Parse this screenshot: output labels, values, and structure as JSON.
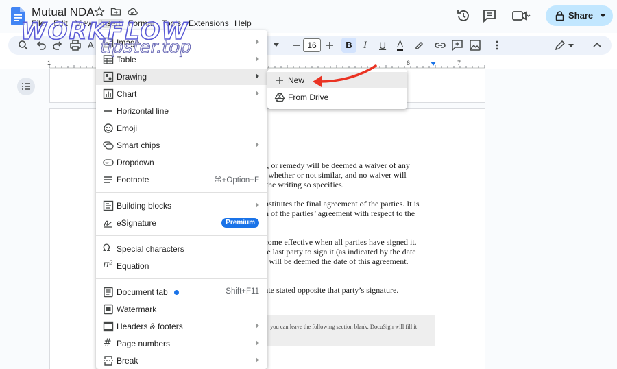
{
  "app": {
    "doc_title": "Mutual NDA",
    "share_label": "Share"
  },
  "menubar": {
    "items": [
      "File",
      "Edit",
      "View",
      "Insert",
      "Format",
      "Tools",
      "Extensions",
      "Help"
    ]
  },
  "toolbar": {
    "font_size": "16",
    "bold_label": "B",
    "italic_label": "I",
    "underline_label": "U",
    "text_color_label": "A",
    "ruler_numbers": [
      "1",
      "6",
      "7"
    ]
  },
  "insert_menu": {
    "items": [
      {
        "label": "Image",
        "icon": "image-icon",
        "submenu": true
      },
      {
        "label": "Table",
        "icon": "table-icon",
        "submenu": true
      },
      {
        "label": "Drawing",
        "icon": "drawing-icon",
        "submenu": true
      },
      {
        "label": "Chart",
        "icon": "chart-icon",
        "submenu": true
      },
      {
        "label": "Horizontal line",
        "icon": "horizontal-line-icon"
      },
      {
        "label": "Emoji",
        "icon": "emoji-icon"
      },
      {
        "label": "Smart chips",
        "icon": "smart-chips-icon",
        "submenu": true
      },
      {
        "label": "Dropdown",
        "icon": "dropdown-icon"
      },
      {
        "label": "Footnote",
        "icon": "footnote-icon",
        "shortcut": "⌘+Option+F"
      },
      {
        "label": "Building blocks",
        "icon": "building-blocks-icon",
        "submenu": true
      },
      {
        "label": "eSignature",
        "icon": "esignature-icon",
        "badge": "Premium"
      },
      {
        "label": "Special characters",
        "icon": "omega-icon"
      },
      {
        "label": "Equation",
        "icon": "pi-icon"
      },
      {
        "label": "Document tab",
        "icon": "document-tab-icon",
        "shortcut": "Shift+F11"
      },
      {
        "label": "Watermark",
        "icon": "watermark-icon"
      },
      {
        "label": "Headers & footers",
        "icon": "headers-footers-icon",
        "submenu": true
      },
      {
        "label": "Page numbers",
        "icon": "hash-icon",
        "submenu": true
      },
      {
        "label": "Break",
        "icon": "break-icon",
        "submenu": true
      }
    ]
  },
  "drawing_submenu": {
    "items": [
      {
        "label": "New",
        "icon": "plus-icon"
      },
      {
        "label": "From Drive",
        "icon": "drive-icon"
      }
    ]
  },
  "document": {
    "lines": [
      "nt, or remedy will be deemed a waiver of any",
      "y, whether or not similar, and no waiver will",
      "s the writing so specifies.",
      "onstitutes the final agreement of the parties. It is",
      "on of the parties’ agreement with respect to the",
      "ecome effective when all parties have signed it.",
      " the last party to sign it (as indicated by the date",
      "e) will be deemed the date of this agreement.",
      "date stated opposite that party’s signature."
    ],
    "gray_note": "you can leave the following section blank. DocuSign will fill it"
  },
  "watermark": {
    "line1": "WORKFLOW",
    "line2": "tipster.top"
  },
  "colors": {
    "accent": "#1a73e8",
    "share_bg": "#c2e7ff",
    "arrow": "#ea3323"
  }
}
